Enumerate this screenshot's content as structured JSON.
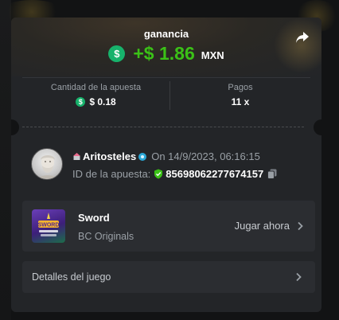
{
  "result": {
    "title": "ganancia",
    "coin_symbol": "$",
    "amount": "+$ 1.86",
    "currency": "MXN",
    "accent_color": "#3bc117"
  },
  "stats": {
    "bet_label": "Cantidad de la apuesta",
    "bet_value": "$ 0.18",
    "payout_label": "Pagos",
    "payout_value": "11 x"
  },
  "user": {
    "name": "Aritosteles",
    "date": "On 14/9/2023, 06:16:15",
    "bet_id_label": "ID de la apuesta:",
    "bet_id": "85698062277674157"
  },
  "game": {
    "name": "Sword",
    "provider": "BC Originals",
    "play_label": "Jugar ahora",
    "thumb_text": "SWORD"
  },
  "details": {
    "label": "Detalles del juego"
  },
  "icons": {
    "share": "share-icon",
    "copy": "copy-icon",
    "verified": "shield-check-icon",
    "chevron": "chevron-right-icon"
  }
}
